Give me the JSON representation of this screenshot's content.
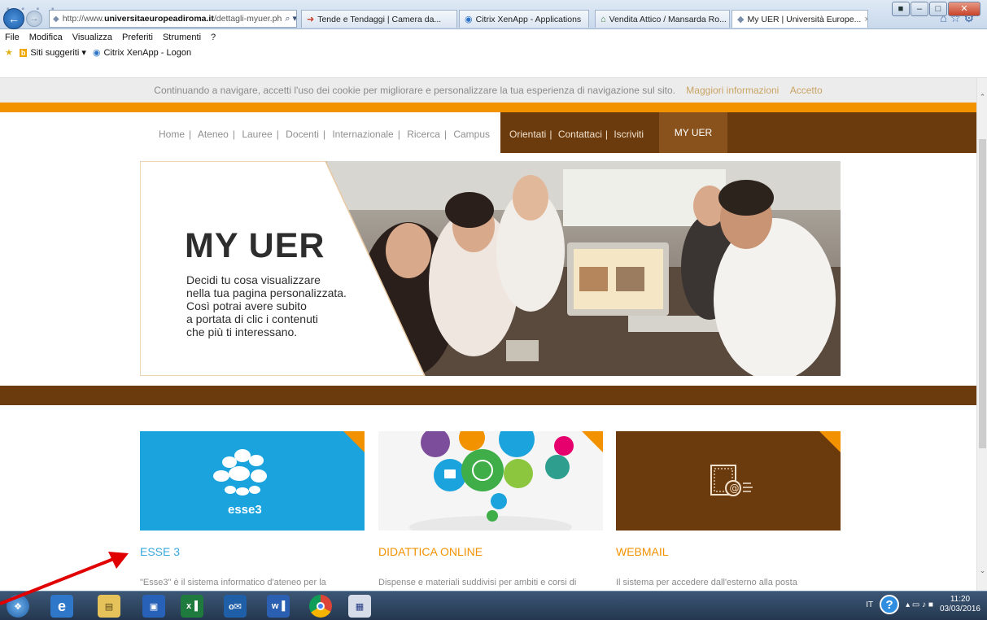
{
  "browser": {
    "address_prefix": "http://www.",
    "address_domain": "universitaeuropeadiroma.it",
    "address_path": "/dettagli-myuer.ph",
    "address_tools": "⌕ ▾ C",
    "tabs": [
      {
        "label": "Tende e Tendaggi | Camera da..."
      },
      {
        "label": "Citrix XenApp - Applications"
      },
      {
        "label": "Vendita Attico / Mansarda Ro..."
      },
      {
        "label": "My UER | Università Europe..."
      }
    ],
    "tab_close": "×",
    "menu": [
      "File",
      "Modifica",
      "Visualizza",
      "Preferiti",
      "Strumenti",
      "?"
    ],
    "favorites": [
      "Siti suggeriti ▾",
      "Citrix XenApp - Logon"
    ]
  },
  "cookie": {
    "text": "Continuando a navigare, accetti l'uso dei cookie per migliorare e personalizzare la tua esperienza di navigazione sul sito.",
    "more": "Maggiori informazioni",
    "accept": "Accetto"
  },
  "nav": {
    "left_items": [
      "Home",
      "Ateneo",
      "Lauree",
      "Docenti",
      "Internazionale",
      "Ricerca",
      "Campus"
    ],
    "right_items": [
      "Orientati",
      "Contattaci",
      "Iscriviti"
    ],
    "separator": "|",
    "active": "MY UER"
  },
  "hero": {
    "title": "MY UER",
    "description_lines": [
      "Decidi tu cosa visualizzare",
      "nella tua pagina personalizzata.",
      "Così potrai avere subito",
      "a portata di clic i contenuti",
      "che più ti interessano."
    ]
  },
  "cards": [
    {
      "title": "ESSE 3",
      "text": "\"Esse3\" è il sistema informatico d'ateneo per la",
      "logo_word": "esse3",
      "icon": "esse3-logo-icon"
    },
    {
      "title": "DIDATTICA ONLINE",
      "text": "Dispense e materiali suddivisi per ambiti e corsi di",
      "icon": "open-book-icon"
    },
    {
      "title": "WEBMAIL",
      "text": "Il sistema per accedere dall'esterno alla posta",
      "icon": "webmail-icon"
    }
  ],
  "taskbar": {
    "apps": [
      "start-icon",
      "ie-icon",
      "explorer-icon",
      "outlook-calendar-icon",
      "excel-icon",
      "outlook-icon",
      "word-icon",
      "chrome-icon",
      "museum-icon"
    ],
    "excel_label": "x▐",
    "outlook_label": "o✉",
    "word_label": "w▐",
    "lang": "IT",
    "help": "?",
    "tray_icons": "▴ ▭ ♪ ■",
    "time": "11:20",
    "date": "03/03/2016"
  },
  "colors": {
    "orange": "#f39200",
    "brown": "#6b3b0e",
    "esse3_blue": "#1aa3dd",
    "link_blue": "#3aa8de",
    "annotation_arrow": "#e00000"
  }
}
